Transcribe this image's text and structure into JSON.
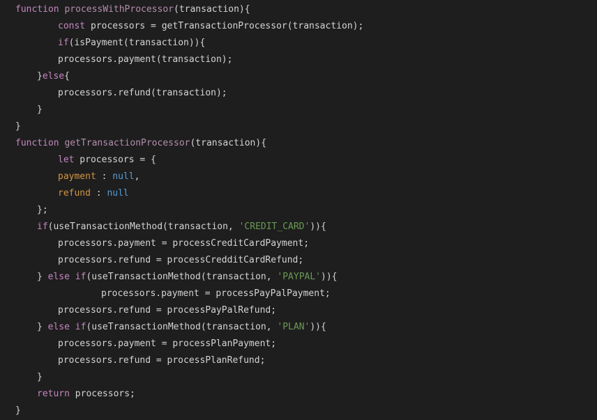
{
  "colors": {
    "background": "#1e1e1e",
    "plain": "#d4d4d4",
    "keyword": "#c586c0",
    "function_name": "#b48ead",
    "property": "#d39540",
    "null": "#569cd6",
    "string": "#6a9955"
  },
  "lines": [
    {
      "indent": 22,
      "tokens": [
        {
          "t": "function",
          "c": "keyword"
        },
        {
          "t": " ",
          "c": "plain"
        },
        {
          "t": "processWithProcessor",
          "c": "fname"
        },
        {
          "t": "(transaction){",
          "c": "plain"
        }
      ]
    },
    {
      "indent": 83,
      "tokens": [
        {
          "t": "const",
          "c": "keyword"
        },
        {
          "t": " processors = getTransactionProcessor(transaction);",
          "c": "plain"
        }
      ]
    },
    {
      "indent": 83,
      "tokens": [
        {
          "t": "if",
          "c": "keyword"
        },
        {
          "t": "(isPayment(transaction)){",
          "c": "plain"
        }
      ]
    },
    {
      "indent": 83,
      "tokens": [
        {
          "t": "processors.payment(transaction);",
          "c": "plain"
        }
      ]
    },
    {
      "indent": 53,
      "tokens": [
        {
          "t": "}",
          "c": "plain"
        },
        {
          "t": "else",
          "c": "keyword"
        },
        {
          "t": "{",
          "c": "plain"
        }
      ]
    },
    {
      "indent": 83,
      "tokens": [
        {
          "t": "processors.refund(transaction);",
          "c": "plain"
        }
      ]
    },
    {
      "indent": 53,
      "tokens": [
        {
          "t": "}",
          "c": "plain"
        }
      ]
    },
    {
      "indent": 22,
      "tokens": [
        {
          "t": "}",
          "c": "plain"
        }
      ]
    },
    {
      "indent": 22,
      "tokens": [
        {
          "t": "function",
          "c": "keyword"
        },
        {
          "t": " ",
          "c": "plain"
        },
        {
          "t": "getTransactionProcessor",
          "c": "fname"
        },
        {
          "t": "(transaction){",
          "c": "plain"
        }
      ]
    },
    {
      "indent": 83,
      "tokens": [
        {
          "t": "let",
          "c": "keyword"
        },
        {
          "t": " processors = {",
          "c": "plain"
        }
      ]
    },
    {
      "indent": 83,
      "tokens": [
        {
          "t": "payment",
          "c": "prop"
        },
        {
          "t": " : ",
          "c": "plain"
        },
        {
          "t": "null",
          "c": "null"
        },
        {
          "t": ",",
          "c": "plain"
        }
      ]
    },
    {
      "indent": 83,
      "tokens": [
        {
          "t": "refund",
          "c": "prop"
        },
        {
          "t": " : ",
          "c": "plain"
        },
        {
          "t": "null",
          "c": "null"
        }
      ]
    },
    {
      "indent": 53,
      "tokens": [
        {
          "t": "};",
          "c": "plain"
        }
      ]
    },
    {
      "indent": 53,
      "tokens": [
        {
          "t": "if",
          "c": "keyword"
        },
        {
          "t": "(useTransactionMethod(transaction, ",
          "c": "plain"
        },
        {
          "t": "'CREDIT_CARD'",
          "c": "string"
        },
        {
          "t": ")){",
          "c": "plain"
        }
      ]
    },
    {
      "indent": 83,
      "tokens": [
        {
          "t": "processors.payment = processCreditCardPayment;",
          "c": "plain"
        }
      ]
    },
    {
      "indent": 83,
      "tokens": [
        {
          "t": "processors.refund = processCredditCardRefund;",
          "c": "plain"
        }
      ]
    },
    {
      "indent": 53,
      "tokens": [
        {
          "t": "} ",
          "c": "plain"
        },
        {
          "t": "else",
          "c": "keyword"
        },
        {
          "t": " ",
          "c": "plain"
        },
        {
          "t": "if",
          "c": "keyword"
        },
        {
          "t": "(useTransactionMethod(transaction, ",
          "c": "plain"
        },
        {
          "t": "'PAYPAL'",
          "c": "string"
        },
        {
          "t": ")){",
          "c": "plain"
        }
      ]
    },
    {
      "indent": 145,
      "tokens": [
        {
          "t": "processors.payment = processPayPalPayment;",
          "c": "plain"
        }
      ]
    },
    {
      "indent": 83,
      "tokens": [
        {
          "t": "processors.refund = processPayPalRefund;",
          "c": "plain"
        }
      ]
    },
    {
      "indent": 53,
      "tokens": [
        {
          "t": "} ",
          "c": "plain"
        },
        {
          "t": "else",
          "c": "keyword"
        },
        {
          "t": " ",
          "c": "plain"
        },
        {
          "t": "if",
          "c": "keyword"
        },
        {
          "t": "(useTransactionMethod(transaction, ",
          "c": "plain"
        },
        {
          "t": "'PLAN'",
          "c": "string"
        },
        {
          "t": ")){",
          "c": "plain"
        }
      ]
    },
    {
      "indent": 83,
      "tokens": [
        {
          "t": "processors.payment = processPlanPayment;",
          "c": "plain"
        }
      ]
    },
    {
      "indent": 83,
      "tokens": [
        {
          "t": "processors.refund = processPlanRefund;",
          "c": "plain"
        }
      ]
    },
    {
      "indent": 53,
      "tokens": [
        {
          "t": "}",
          "c": "plain"
        }
      ]
    },
    {
      "indent": 53,
      "tokens": [
        {
          "t": "return",
          "c": "keyword"
        },
        {
          "t": " processors;",
          "c": "plain"
        }
      ]
    },
    {
      "indent": 22,
      "tokens": [
        {
          "t": "}",
          "c": "plain"
        }
      ]
    }
  ]
}
